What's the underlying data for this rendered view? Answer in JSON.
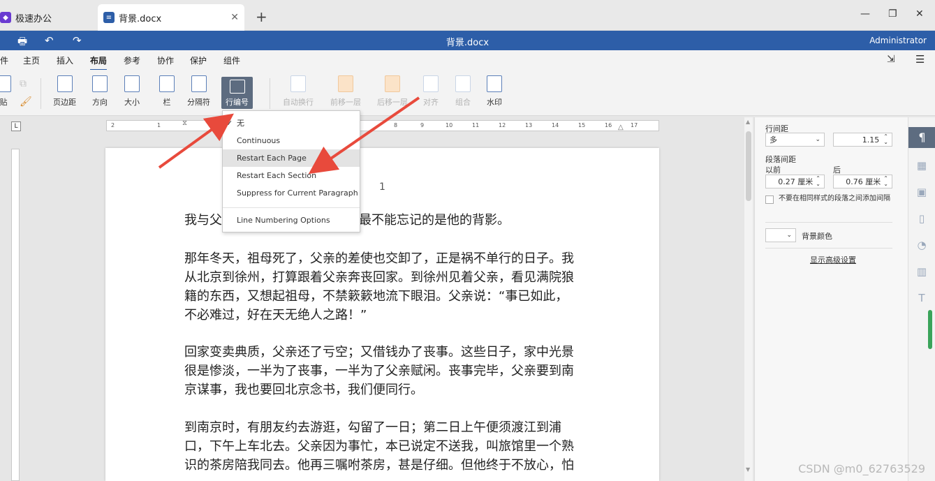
{
  "tabs": [
    {
      "label": "极速办公"
    },
    {
      "label": "背景.docx"
    }
  ],
  "title": "背景.docx",
  "user": "Administrator",
  "menus": [
    "件",
    "主页",
    "插入",
    "布局",
    "参考",
    "协作",
    "保护",
    "组件"
  ],
  "active_menu": "布局",
  "ribbon": {
    "paste": "贴",
    "margins": "页边距",
    "orientation": "方向",
    "size": "大小",
    "columns": "栏",
    "breaks": "分隔符",
    "line_numbers": "行编号",
    "wrap": "自动换行",
    "bring_forward": "前移一层",
    "send_backward": "后移一层",
    "align": "对齐",
    "group": "组合",
    "watermark": "水印"
  },
  "dropdown": {
    "items": [
      {
        "label": "无",
        "checked": true
      },
      {
        "label": "Continuous"
      },
      {
        "label": "Restart Each Page",
        "highlighted": true
      },
      {
        "label": "Restart Each Section"
      },
      {
        "label": "Suppress for Current Paragraph"
      },
      {
        "label": "Line Numbering Options"
      }
    ],
    "check": "✓"
  },
  "ruler_numbers": [
    "2",
    "1",
    "8",
    "9",
    "10",
    "11",
    "12",
    "13",
    "14",
    "15",
    "16",
    "17"
  ],
  "document": {
    "page_number": "1",
    "paragraphs": [
      {
        "lines": [
          "我与父",
          "我最不能忘记的是他的背影。"
        ]
      },
      {
        "lines": [
          "那年冬天，祖母死了，父亲的差使也交卸了，正是祸不单行的日子。我",
          "从北京到徐州，打算跟着父亲奔丧回家。到徐州见着父亲，看见满院狼",
          "籍的东西，又想起祖母，不禁簌簌地流下眼泪。父亲说：“事已如此，",
          "不必难过，好在天无绝人之路！”"
        ]
      },
      {
        "lines": [
          "回家变卖典质，父亲还了亏空；又借钱办了丧事。这些日子，家中光景",
          "很是惨淡，一半为了丧事，一半为了父亲赋闲。丧事完毕，父亲要到南",
          "京谋事，我也要回北京念书，我们便同行。"
        ]
      },
      {
        "lines": [
          "到南京时，有朋友约去游逛，勾留了一日；第二日上午便须渡江到浦",
          "口，下午上车北去。父亲因为事忙，本已说定不送我，叫旅馆里一个熟",
          "识的茶房陪我同去。他再三嘱咐茶房，甚是仔细。但他终于不放心，怕"
        ]
      }
    ]
  },
  "panel": {
    "line_spacing_label": "行间距",
    "line_spacing_type": "多",
    "line_spacing_value": "1.15",
    "para_spacing_label": "段落间距",
    "before_label": "以前",
    "after_label": "后",
    "before_value": "0.27 厘米",
    "after_value": "0.76 厘米",
    "no_space_checkbox": "不要在相同样式的段落之间添加间隔",
    "bg_color_label": "背景颜色",
    "advanced_link": "显示高级设置"
  },
  "watermark_text": "CSDN @m0_62763529",
  "colors": {
    "titlebar": "#2d5ea8",
    "arrow": "#e84a3c",
    "selected_button": "#5d6c80"
  }
}
